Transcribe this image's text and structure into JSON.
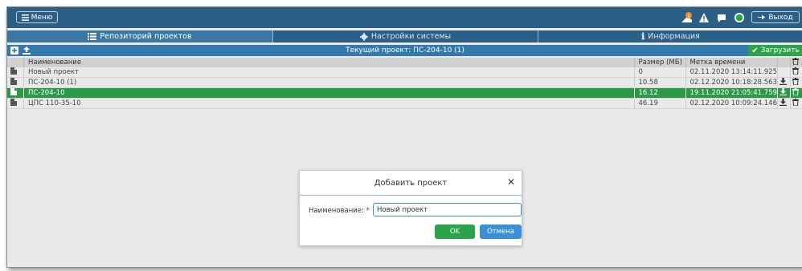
{
  "topbar": {
    "menu_label": "Меню",
    "logout_label": "Выход",
    "notification_count": "1"
  },
  "tabs": [
    {
      "label": "Репозиторий проектов",
      "icon": "list-icon",
      "active": true
    },
    {
      "label": "Настройки системы",
      "icon": "gear-icon",
      "active": false
    },
    {
      "label": "Информация",
      "icon": "info-icon",
      "active": false
    }
  ],
  "project_bar": {
    "title": "Текущий проект: ПС-204-10 (1)",
    "upload_label": "Загрузить"
  },
  "table": {
    "headers": {
      "name": "Наименование",
      "size": "Размер (МБ)",
      "time": "Метка времени"
    },
    "rows": [
      {
        "name": "Новый проект",
        "size": "0",
        "time": "02.11.2020 13:14:11.925",
        "selected": false,
        "downloadable": false
      },
      {
        "name": "ПС-204-10 (1)",
        "size": "10.58",
        "time": "02.12.2020 10:18:28.563",
        "selected": false,
        "downloadable": true
      },
      {
        "name": "ПС-204-10",
        "size": "16.12",
        "time": "19.11.2020 21:05:41.759",
        "selected": true,
        "downloadable": true
      },
      {
        "name": "ЦПС 110-35-10",
        "size": "46.19",
        "time": "02.12.2020 10:09:24.146",
        "selected": false,
        "downloadable": true
      }
    ]
  },
  "modal": {
    "title": "Добавить проект",
    "name_label": "Наименование:",
    "required_mark": "*",
    "name_value": "Новый проект",
    "ok_label": "OK",
    "cancel_label": "Отмена"
  },
  "colors": {
    "header_blue": "#2b5f86",
    "bar_blue": "#3479ac",
    "selected_green": "#2a9a46",
    "ok_green": "#2aa34a",
    "cancel_blue": "#3a8fd6"
  }
}
